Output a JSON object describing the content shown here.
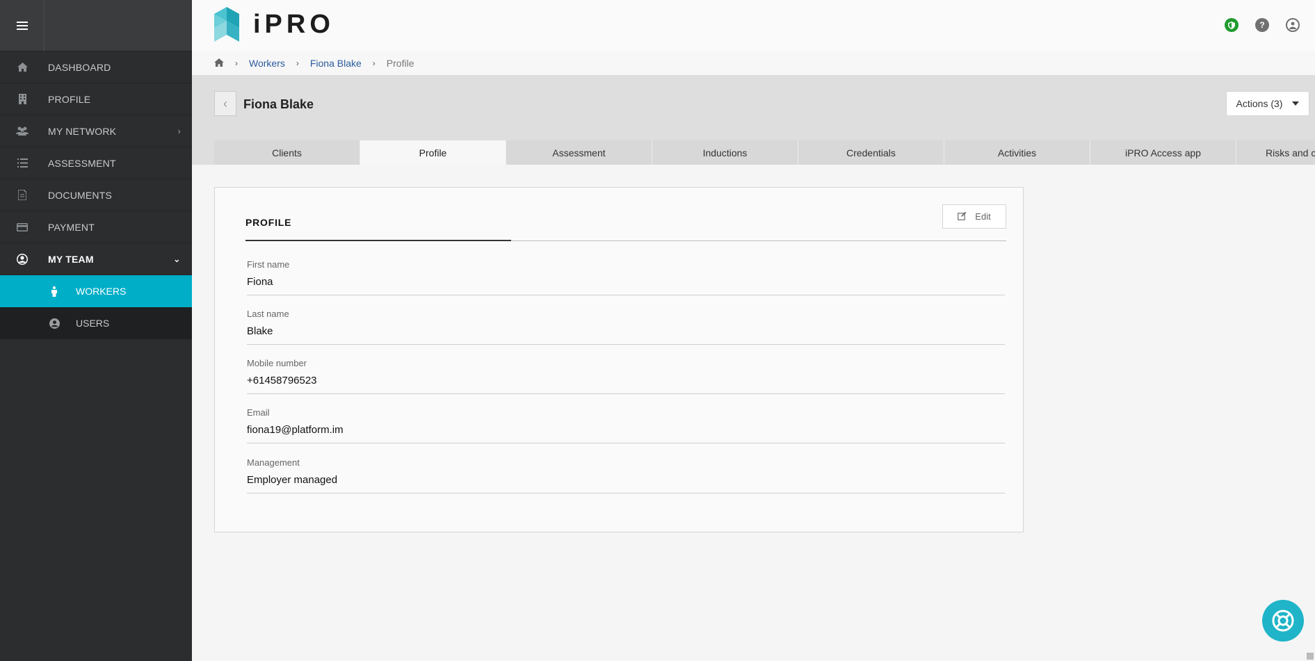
{
  "app": {
    "logo_text": "iPRO"
  },
  "sidebar": {
    "items": [
      {
        "label": "DASHBOARD",
        "icon": "home-icon"
      },
      {
        "label": "PROFILE",
        "icon": "building-icon"
      },
      {
        "label": "MY NETWORK",
        "icon": "users-icon"
      },
      {
        "label": "ASSESSMENT",
        "icon": "list-icon"
      },
      {
        "label": "DOCUMENTS",
        "icon": "document-icon"
      },
      {
        "label": "PAYMENT",
        "icon": "credit-card-icon"
      },
      {
        "label": "MY TEAM",
        "icon": "user-circle-icon"
      }
    ],
    "sub_items": [
      {
        "label": "WORKERS",
        "icon": "person-icon"
      },
      {
        "label": "USERS",
        "icon": "user-circle-icon"
      }
    ]
  },
  "breadcrumb": {
    "items": [
      "Workers",
      "Fiona Blake"
    ],
    "current": "Profile"
  },
  "page": {
    "title": "Fiona Blake",
    "actions_label": "Actions (3)"
  },
  "tabs": [
    {
      "label": "Clients"
    },
    {
      "label": "Profile"
    },
    {
      "label": "Assessment"
    },
    {
      "label": "Inductions"
    },
    {
      "label": "Credentials"
    },
    {
      "label": "Activities"
    },
    {
      "label": "iPRO Access app"
    },
    {
      "label": "Risks and c"
    }
  ],
  "profile_card": {
    "title": "PROFILE",
    "edit_label": "Edit",
    "fields": [
      {
        "label": "First name",
        "value": "Fiona"
      },
      {
        "label": "Last name",
        "value": "Blake"
      },
      {
        "label": "Mobile number",
        "value": "+61458796523"
      },
      {
        "label": "Email",
        "value": "fiona19@platform.im"
      },
      {
        "label": "Management",
        "value": "Employer managed"
      }
    ]
  },
  "colors": {
    "sidebar_bg": "#2b2d2f",
    "accent": "#00aec7",
    "shield_green": "#1f9b2e",
    "link": "#2a5b9c"
  }
}
